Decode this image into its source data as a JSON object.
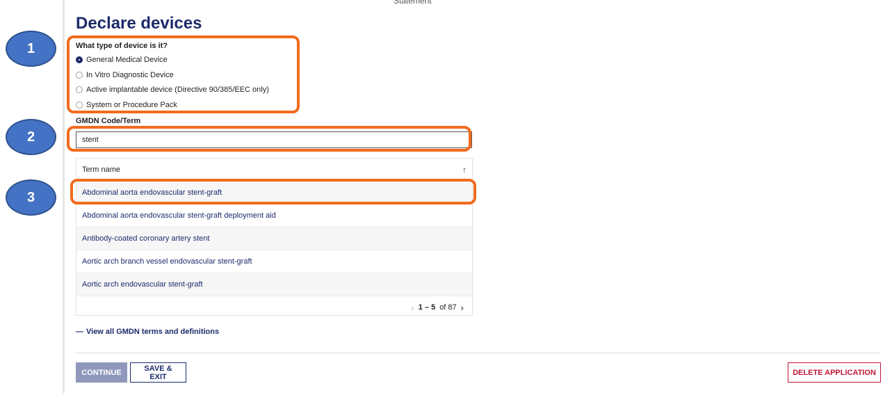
{
  "header": {
    "statement_text": "Statement"
  },
  "page_title": "Declare devices",
  "device_type": {
    "question": "What type of device is it?",
    "options": [
      {
        "label": "General Medical Device",
        "selected": true
      },
      {
        "label": "In Vitro Diagnostic Device",
        "selected": false
      },
      {
        "label": "Active implantable device (Directive 90/385/EEC only)",
        "selected": false
      },
      {
        "label": "System or Procedure Pack",
        "selected": false
      }
    ]
  },
  "gmdn": {
    "label": "GMDN Code/Term",
    "value": "stent"
  },
  "results": {
    "column_header": "Term name",
    "sort_icon": "arrow-up-icon",
    "rows": [
      "Abdominal aorta endovascular stent-graft",
      "Abdominal aorta endovascular stent-graft deployment aid",
      "Antibody-coated coronary artery stent",
      "Aortic arch branch vessel endovascular stent-graft",
      "Aortic arch endovascular stent-graft"
    ],
    "pagination": {
      "range": "1 – 5",
      "of_text": "of 87"
    }
  },
  "view_all_link": "View all GMDN terms and definitions",
  "buttons": {
    "continue": "CONTINUE",
    "save_exit": "SAVE & EXIT",
    "delete": "DELETE APPLICATION"
  },
  "callouts": [
    "1",
    "2",
    "3"
  ],
  "colors": {
    "primary": "#1d2b6b",
    "danger": "#c0163a",
    "highlight": "#f26b1d",
    "callout": "#4472c4"
  }
}
